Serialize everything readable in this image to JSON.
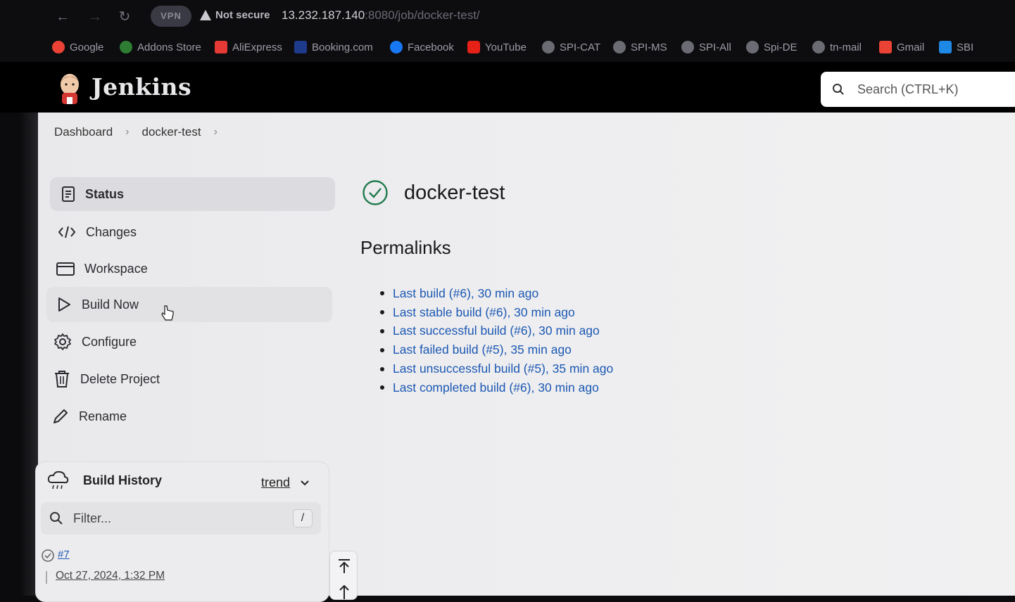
{
  "browser": {
    "vpn_label": "VPN",
    "security_label": "Not secure",
    "url_host": "13.232.187.140",
    "url_rest": ":8080/job/docker-test/",
    "bookmarks": [
      {
        "label": "Google",
        "color": "#ea4335"
      },
      {
        "label": "Addons Store",
        "color": "#2e7d32"
      },
      {
        "label": "AliExpress",
        "color": "#e53935"
      },
      {
        "label": "Booking.com",
        "color": "#1e3a8a"
      },
      {
        "label": "Facebook",
        "color": "#1877f2"
      },
      {
        "label": "YouTube",
        "color": "#e62117"
      },
      {
        "label": "SPI-CAT",
        "color": "#6b6b74"
      },
      {
        "label": "SPI-MS",
        "color": "#6b6b74"
      },
      {
        "label": "SPI-All",
        "color": "#6b6b74"
      },
      {
        "label": "Spi-DE",
        "color": "#6b6b74"
      },
      {
        "label": "tn-mail",
        "color": "#6b6b74"
      },
      {
        "label": "Gmail",
        "color": "#ea4335"
      },
      {
        "label": "SBI",
        "color": "#1e88e5"
      }
    ]
  },
  "header": {
    "brand": "Jenkins",
    "search_placeholder": "Search (CTRL+K)"
  },
  "breadcrumb": [
    "Dashboard",
    "docker-test"
  ],
  "sidebar": {
    "items": [
      {
        "label": "Status",
        "icon": "document-icon"
      },
      {
        "label": "Changes",
        "icon": "code-icon"
      },
      {
        "label": "Workspace",
        "icon": "folder-icon"
      },
      {
        "label": "Build Now",
        "icon": "play-icon"
      },
      {
        "label": "Configure",
        "icon": "gear-icon"
      },
      {
        "label": "Delete Project",
        "icon": "trash-icon"
      },
      {
        "label": "Rename",
        "icon": "pencil-icon"
      }
    ]
  },
  "main": {
    "project_title": "docker-test",
    "permalinks_heading": "Permalinks",
    "permalinks": [
      "Last build (#6), 30 min ago",
      "Last stable build (#6), 30 min ago",
      "Last successful build (#6), 30 min ago",
      "Last failed build (#5), 35 min ago",
      "Last unsuccessful build (#5), 35 min ago",
      "Last completed build (#6), 30 min ago"
    ]
  },
  "build_history": {
    "title": "Build History",
    "trend_label": "trend",
    "filter_placeholder": "Filter...",
    "filter_shortcut": "/",
    "builds": [
      {
        "number": "#7",
        "date": "Oct 27, 2024, 1:32 PM"
      }
    ]
  },
  "colors": {
    "link": "#1c58b3",
    "success": "#1f7a4d"
  }
}
